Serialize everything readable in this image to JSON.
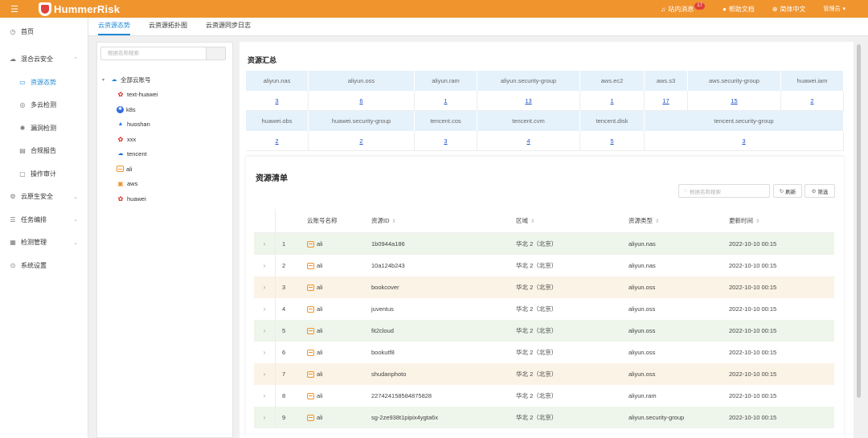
{
  "header": {
    "logo": "HummerRisk",
    "messages_label": "站内消息",
    "messages_badge": "17",
    "help_label": "帮助文档",
    "lang_label": "简体中文",
    "user_label": "管理员"
  },
  "sidebar": {
    "items": [
      {
        "label": "首页"
      },
      {
        "label": "混合云安全"
      },
      {
        "label": "资源态势"
      },
      {
        "label": "多云检测"
      },
      {
        "label": "漏洞检测"
      },
      {
        "label": "合规报告"
      },
      {
        "label": "操作审计"
      },
      {
        "label": "云原生安全"
      },
      {
        "label": "任务编排"
      },
      {
        "label": "检测管理"
      },
      {
        "label": "系统设置"
      }
    ]
  },
  "tabs": [
    "云资源态势",
    "云资源拓扑图",
    "云资源同步日志"
  ],
  "tree": {
    "search_placeholder": "根据名称搜索",
    "root": "全部云账号",
    "children": [
      "text-huawei",
      "k8s",
      "huoshan",
      "xxx",
      "tencent",
      "ali",
      "aws",
      "huawei"
    ]
  },
  "summary": {
    "title": "资源汇总",
    "row1_headers": [
      "aliyun.nas",
      "aliyun.oss",
      "aliyun.ram",
      "aliyun.security-group",
      "aws.ec2",
      "aws.s3",
      "aws.security-group",
      "huawei.iam"
    ],
    "row1_values": [
      "3",
      "6",
      "1",
      "13",
      "1",
      "17",
      "15",
      "2"
    ],
    "row2_headers": [
      "huawei.obs",
      "huawei.security-group",
      "tencent.cos",
      "tencent.cvm",
      "tencent.disk",
      "tencent.security-group"
    ],
    "row2_values": [
      "2",
      "2",
      "3",
      "4",
      "5",
      "3"
    ]
  },
  "list": {
    "title": "资源清单",
    "search_placeholder": "根据名称搜索",
    "refresh_label": "刷新",
    "filter_label": "筛选",
    "columns": [
      "云账号名称",
      "资源ID",
      "区域",
      "资源类型",
      "更新时间"
    ],
    "rows": [
      {
        "no": "1",
        "account": "ali",
        "id": "1b0944a186",
        "region": "华北 2（北京）",
        "type": "aliyun.nas",
        "time": "2022-10-10 00:15"
      },
      {
        "no": "2",
        "account": "ali",
        "id": "10a124b243",
        "region": "华北 2（北京）",
        "type": "aliyun.nas",
        "time": "2022-10-10 00:15"
      },
      {
        "no": "3",
        "account": "ali",
        "id": "bookcover",
        "region": "华北 2（北京）",
        "type": "aliyun.oss",
        "time": "2022-10-10 00:15"
      },
      {
        "no": "4",
        "account": "ali",
        "id": "juventus",
        "region": "华北 2（北京）",
        "type": "aliyun.oss",
        "time": "2022-10-10 00:15"
      },
      {
        "no": "5",
        "account": "ali",
        "id": "fit2cloud",
        "region": "华北 2（北京）",
        "type": "aliyun.oss",
        "time": "2022-10-10 00:15"
      },
      {
        "no": "6",
        "account": "ali",
        "id": "bookutf8",
        "region": "华北 2（北京）",
        "type": "aliyun.oss",
        "time": "2022-10-10 00:15"
      },
      {
        "no": "7",
        "account": "ali",
        "id": "shudanphoto",
        "region": "华北 2（北京）",
        "type": "aliyun.oss",
        "time": "2022-10-10 00:15"
      },
      {
        "no": "8",
        "account": "ali",
        "id": "227424158584875828",
        "region": "华北 2（北京）",
        "type": "aliyun.ram",
        "time": "2022-10-10 00:15"
      },
      {
        "no": "9",
        "account": "ali",
        "id": "sg-2ze938t1pipix4ygta6x",
        "region": "华北 2（北京）",
        "type": "aliyun.security-group",
        "time": "2022-10-10 00:15"
      }
    ]
  }
}
